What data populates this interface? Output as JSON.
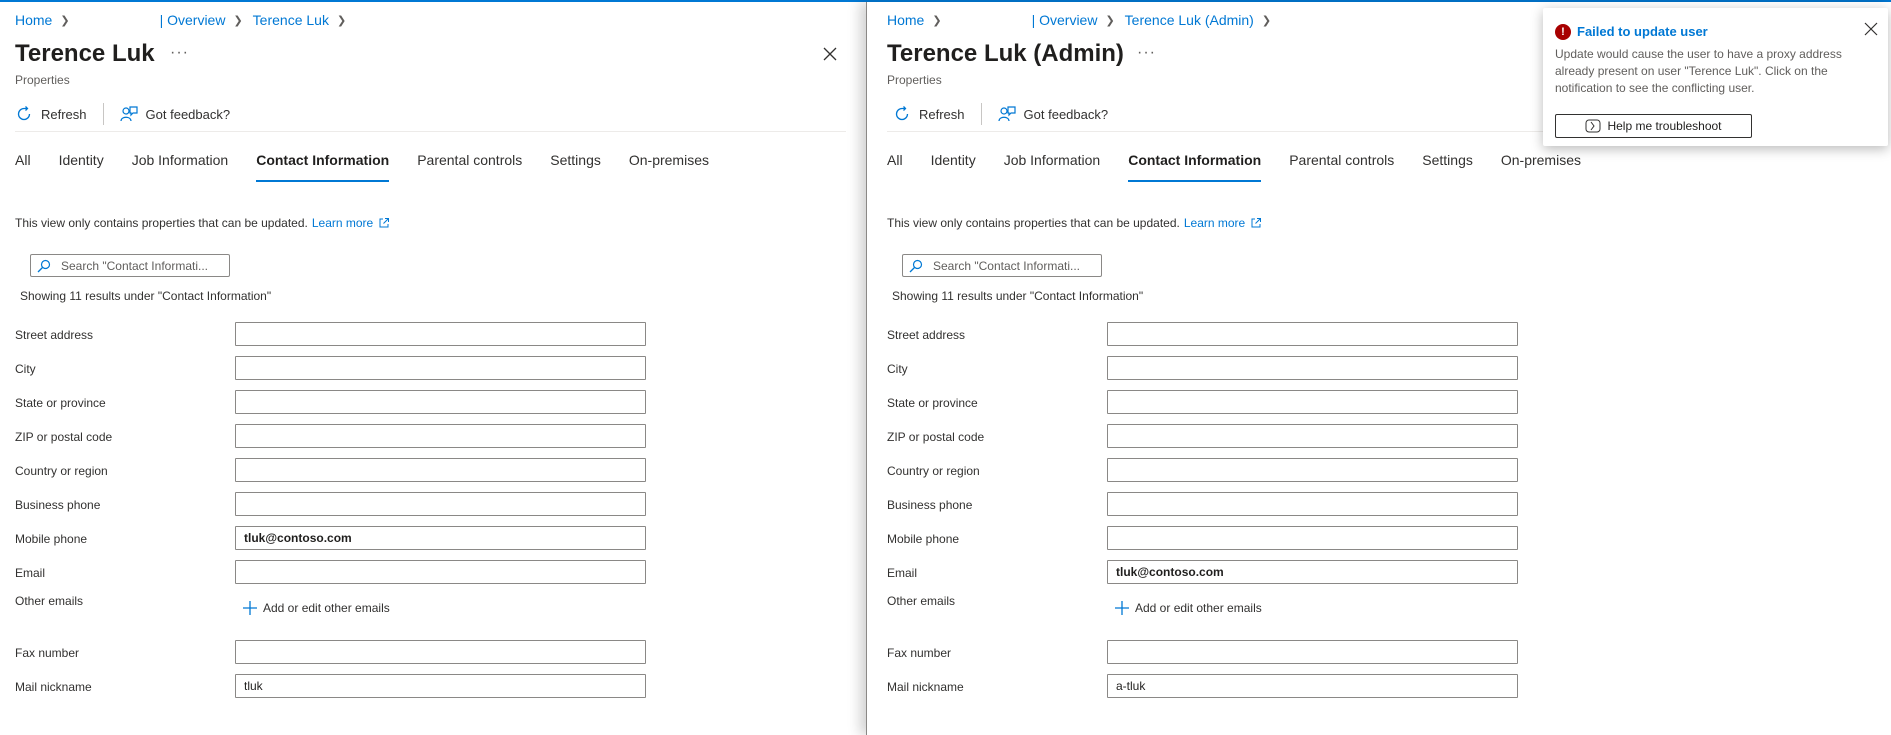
{
  "left_pane": {
    "breadcrumb": {
      "home": "Home",
      "overview": "| Overview",
      "user": "Terence Luk"
    },
    "title": "Terence Luk",
    "more": "···",
    "subtitle": "Properties",
    "toolbar": {
      "refresh": "Refresh",
      "feedback": "Got feedback?"
    },
    "tabs": [
      "All",
      "Identity",
      "Job Information",
      "Contact Information",
      "Parental controls",
      "Settings",
      "On-premises"
    ],
    "active_tab": "Contact Information",
    "info_text": "This view only contains properties that can be updated.",
    "learn_more": "Learn more",
    "search_placeholder": "Search \"Contact Informati...",
    "results_text": "Showing 11 results under \"Contact Information\"",
    "fields": {
      "street_address": {
        "label": "Street address",
        "value": ""
      },
      "city": {
        "label": "City",
        "value": ""
      },
      "state": {
        "label": "State or province",
        "value": ""
      },
      "zip": {
        "label": "ZIP or postal code",
        "value": ""
      },
      "country": {
        "label": "Country or region",
        "value": ""
      },
      "business_phone": {
        "label": "Business phone",
        "value": ""
      },
      "mobile_phone": {
        "label": "Mobile phone",
        "value": "tluk@contoso.com"
      },
      "email": {
        "label": "Email",
        "value": ""
      },
      "other_emails": {
        "label": "Other emails",
        "action": "Add or edit other emails"
      },
      "fax": {
        "label": "Fax number",
        "value": ""
      },
      "mail_nickname": {
        "label": "Mail nickname",
        "value": "tluk"
      }
    }
  },
  "right_pane": {
    "breadcrumb": {
      "home": "Home",
      "overview": "| Overview",
      "user": "Terence Luk (Admin)"
    },
    "title": "Terence Luk (Admin)",
    "more": "···",
    "subtitle": "Properties",
    "toolbar": {
      "refresh": "Refresh",
      "feedback": "Got feedback?"
    },
    "tabs": [
      "All",
      "Identity",
      "Job Information",
      "Contact Information",
      "Parental controls",
      "Settings",
      "On-premises"
    ],
    "active_tab": "Contact Information",
    "info_text": "This view only contains properties that can be updated.",
    "learn_more": "Learn more",
    "search_placeholder": "Search \"Contact Informati...",
    "results_text": "Showing 11 results under \"Contact Information\"",
    "fields": {
      "street_address": {
        "label": "Street address",
        "value": ""
      },
      "city": {
        "label": "City",
        "value": ""
      },
      "state": {
        "label": "State or province",
        "value": ""
      },
      "zip": {
        "label": "ZIP or postal code",
        "value": ""
      },
      "country": {
        "label": "Country or region",
        "value": ""
      },
      "business_phone": {
        "label": "Business phone",
        "value": ""
      },
      "mobile_phone": {
        "label": "Mobile phone",
        "value": ""
      },
      "email": {
        "label": "Email",
        "value": "tluk@contoso.com"
      },
      "other_emails": {
        "label": "Other emails",
        "action": "Add or edit other emails"
      },
      "fax": {
        "label": "Fax number",
        "value": ""
      },
      "mail_nickname": {
        "label": "Mail nickname",
        "value": "a-tluk"
      }
    }
  },
  "notification": {
    "title": "Failed to update user",
    "message": "Update would cause the user to have a proxy address already present on user \"Terence Luk\". Click on the notification to see the conflicting user.",
    "button": "Help me troubleshoot",
    "status_color": "#a80000"
  },
  "colors": {
    "accent": "#0078d4",
    "error": "#a80000"
  },
  "icons": [
    "refresh-icon",
    "feedback-icon",
    "close-icon",
    "search-icon",
    "external-link-icon",
    "plus-icon",
    "error-icon",
    "troubleshoot-icon"
  ]
}
